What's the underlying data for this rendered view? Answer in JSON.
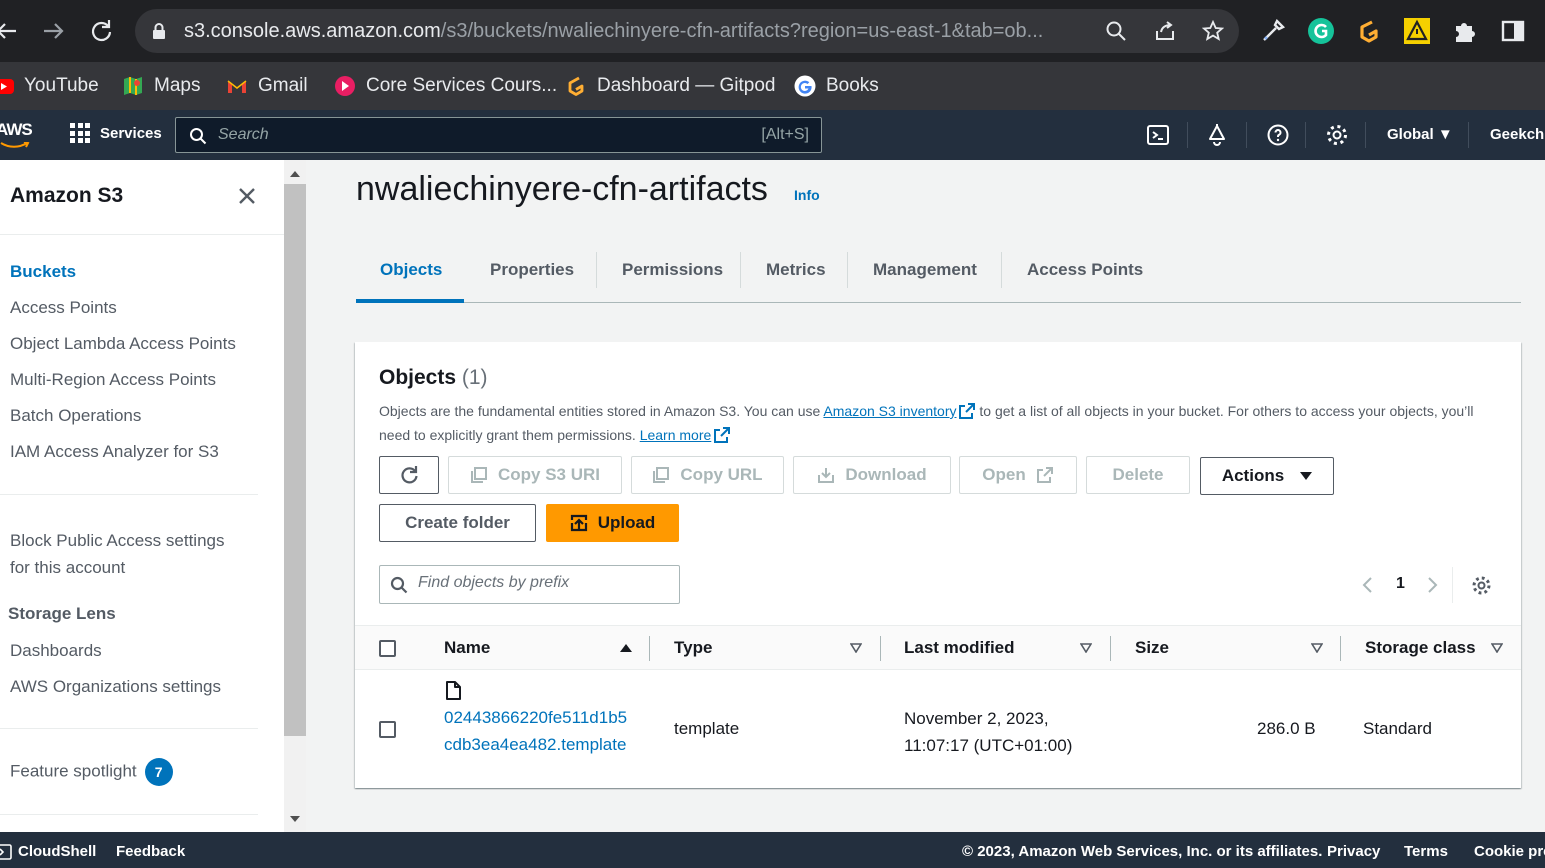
{
  "browser": {
    "url_host": "s3.console.aws.amazon.com",
    "url_rest": "/s3/buckets/nwaliechinyere-cfn-artifacts?region=us-east-1&tab=ob..."
  },
  "bookmarks": [
    {
      "label": "YouTube",
      "icon": "youtube-icon"
    },
    {
      "label": "Maps",
      "icon": "maps-icon"
    },
    {
      "label": "Gmail",
      "icon": "gmail-icon"
    },
    {
      "label": "Core Services Cours...",
      "icon": "core-services-icon"
    },
    {
      "label": "Dashboard — Gitpod",
      "icon": "gitpod-icon"
    },
    {
      "label": "Books",
      "icon": "google-icon"
    }
  ],
  "aws_header": {
    "logo": "AWS",
    "services": "Services",
    "search_placeholder": "Search",
    "search_shortcut": "[Alt+S]",
    "region": "Global",
    "account": "Geekchin"
  },
  "sidebar": {
    "title": "Amazon S3",
    "items": [
      "Buckets",
      "Access Points",
      "Object Lambda Access Points",
      "Multi-Region Access Points",
      "Batch Operations",
      "IAM Access Analyzer for S3"
    ],
    "block_public_line1": "Block Public Access settings",
    "block_public_line2": "for this account",
    "storage_lens": "Storage Lens",
    "lens_items": [
      "Dashboards",
      "AWS Organizations settings"
    ],
    "feature_spotlight": "Feature spotlight",
    "feature_count": "7"
  },
  "bucket": {
    "name": "nwaliechinyere-cfn-artifacts",
    "info": "Info"
  },
  "tabs": [
    "Objects",
    "Properties",
    "Permissions",
    "Metrics",
    "Management",
    "Access Points"
  ],
  "objects_panel": {
    "title": "Objects",
    "count": "(1)",
    "desc_1": "Objects are the fundamental entities stored in Amazon S3. You can use ",
    "desc_link1": "Amazon S3 inventory",
    "desc_2": " to get a list of all objects in your bucket. For others to access your objects, you’ll need to explicitly grant them permissions. ",
    "desc_link2": "Learn more",
    "buttons": {
      "copy_uri": "Copy S3 URI",
      "copy_url": "Copy URL",
      "download": "Download",
      "open": "Open",
      "delete": "Delete",
      "actions": "Actions",
      "create_folder": "Create folder",
      "upload": "Upload"
    },
    "filter_placeholder": "Find objects by prefix",
    "page": "1",
    "columns": [
      "Name",
      "Type",
      "Last modified",
      "Size",
      "Storage class"
    ],
    "rows": [
      {
        "name": "02443866220fe511d1b5cdb3ea4ea482.template",
        "type": "template",
        "modified_line1": "November 2, 2023,",
        "modified_line2": "11:07:17 (UTC+01:00)",
        "size": "286.0 B",
        "storage_class": "Standard"
      }
    ]
  },
  "footer": {
    "cloudshell": "CloudShell",
    "feedback": "Feedback",
    "copyright": "© 2023, Amazon Web Services, Inc. or its affiliates.",
    "privacy": "Privacy",
    "terms": "Terms",
    "cookie": "Cookie pref"
  },
  "colors": {
    "link": "#0073bb",
    "upload": "#ff9900",
    "aws_header": "#232f3e"
  }
}
